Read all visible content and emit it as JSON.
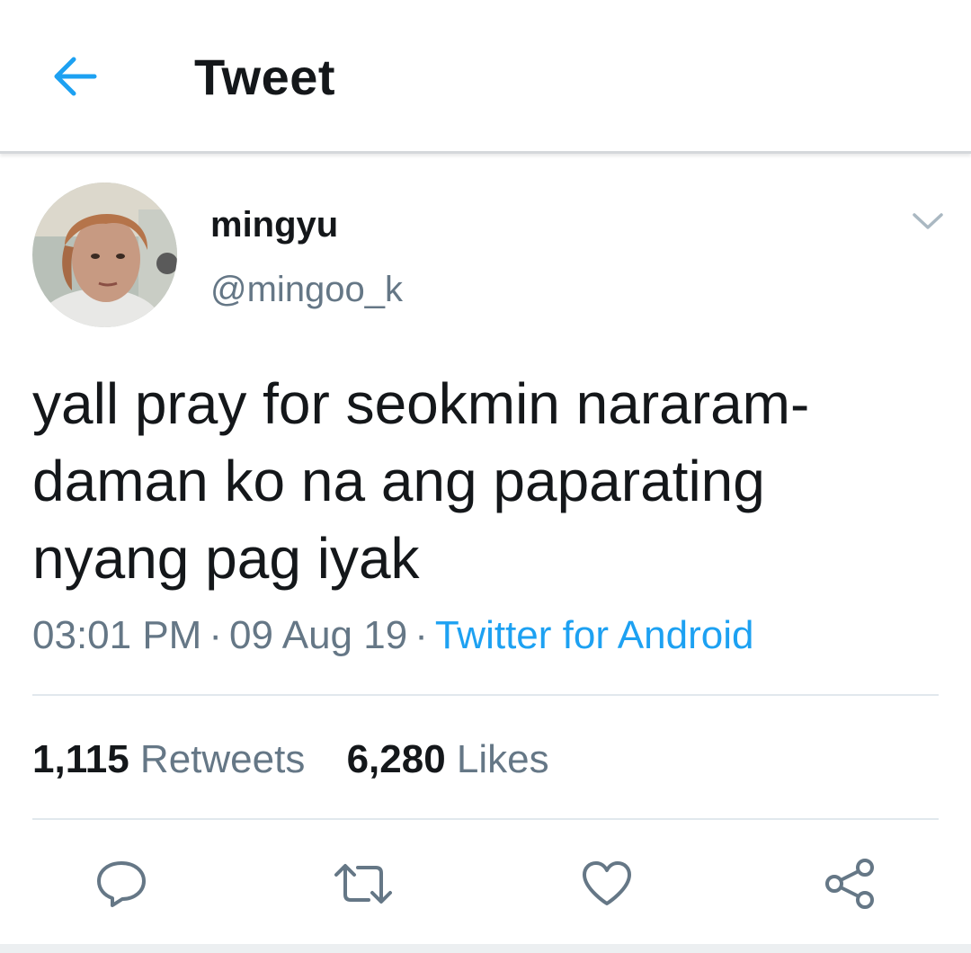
{
  "header": {
    "title": "Tweet",
    "back_icon": "arrow-left-icon"
  },
  "author": {
    "display_name": "mingyu",
    "handle": "@mingoo_k"
  },
  "tweet": {
    "text_lines": [
      "yall pray for seokmin nararam-",
      "daman ko na ang paparating",
      "nyang pag iyak"
    ],
    "time": "03:01 PM",
    "separator": "·",
    "date": "09 Aug 19",
    "source": "Twitter for Android"
  },
  "stats": {
    "retweets_count": "1,115",
    "retweets_label": "Retweets",
    "likes_count": "6,280",
    "likes_label": "Likes"
  },
  "actions": [
    {
      "name": "reply",
      "icon": "reply-icon"
    },
    {
      "name": "retweet",
      "icon": "retweet-icon"
    },
    {
      "name": "like",
      "icon": "heart-icon"
    },
    {
      "name": "share",
      "icon": "share-icon"
    }
  ],
  "colors": {
    "accent": "#1da1f2",
    "text_primary": "#14171a",
    "text_secondary": "#657786",
    "divider": "#e1e8ed"
  }
}
